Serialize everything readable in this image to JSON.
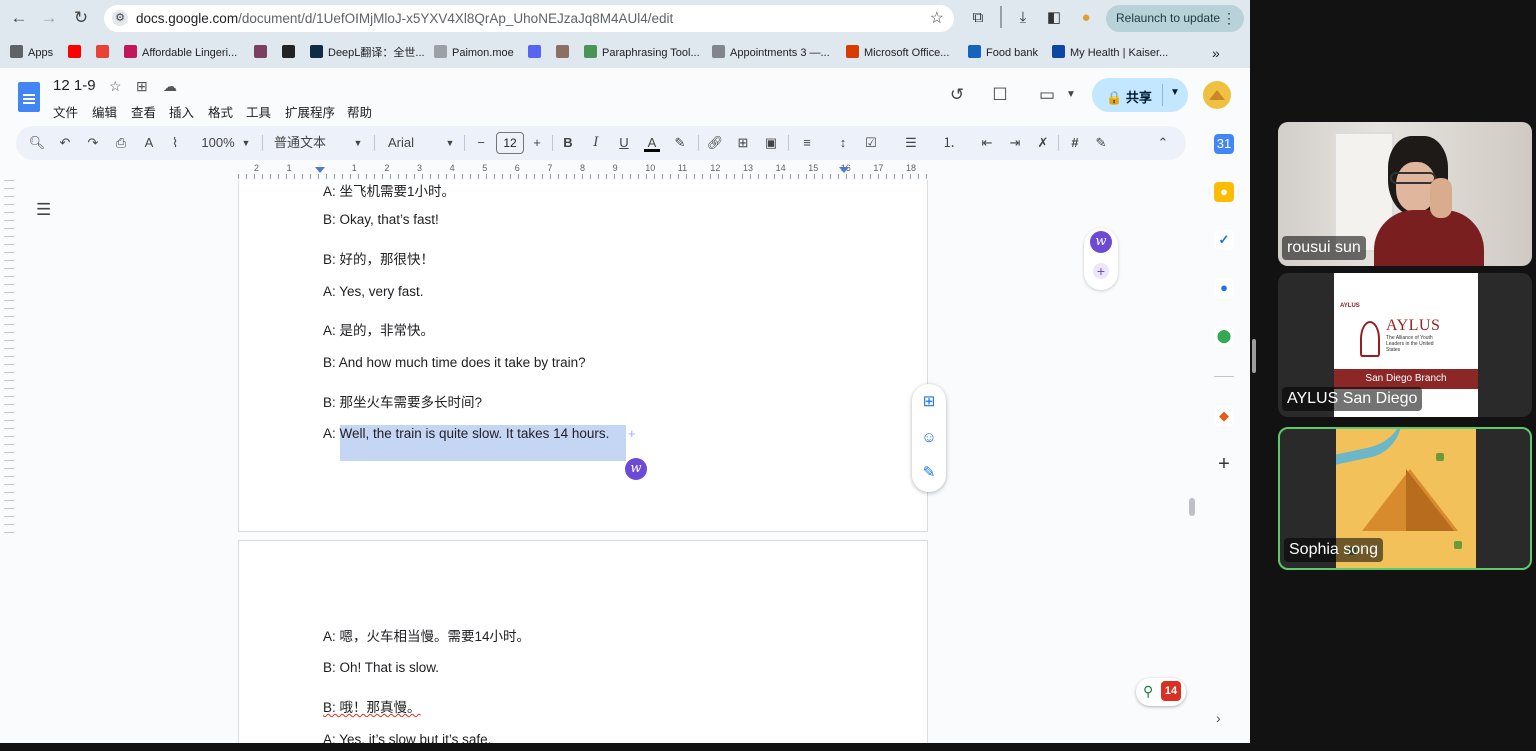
{
  "browser": {
    "url_host": "docs.google.com",
    "url_path": "/document/d/1UefOIMjMloJ-x5YXV4Xl8QrAp_UhoNEJzaJq8M4AUl4/edit",
    "relaunch_label": "Relaunch to update",
    "bookmarks": [
      {
        "label": "Apps",
        "icon": "apps-grid-icon",
        "color": "#5f6368"
      },
      {
        "label": "",
        "icon": "youtube-icon",
        "color": "#ff0000"
      },
      {
        "label": "",
        "icon": "gmail-icon",
        "color": "#ea4335"
      },
      {
        "label": "Affordable Lingeri...",
        "icon": "lingerie-site-icon",
        "color": "#c2185b"
      },
      {
        "label": "",
        "icon": "bookmark-site-icon",
        "color": "#7b3f61"
      },
      {
        "label": "",
        "icon": "amazon-icon",
        "color": "#222222"
      },
      {
        "label": "DeepL翻译：全世...",
        "icon": "deepl-icon",
        "color": "#0f2b46"
      },
      {
        "label": "Paimon.moe",
        "icon": "paimon-icon",
        "color": "#9aa0a6"
      },
      {
        "label": "",
        "icon": "discord-icon",
        "color": "#5865f2"
      },
      {
        "label": "",
        "icon": "site-icon",
        "color": "#8d6e63"
      },
      {
        "label": "Paraphrasing Tool...",
        "icon": "quillbot-icon",
        "color": "#499557"
      },
      {
        "label": "Appointments 3 —...",
        "icon": "calendar-grid-icon",
        "color": "#80868b"
      },
      {
        "label": "Microsoft Office...",
        "icon": "office-icon",
        "color": "#d83b01"
      },
      {
        "label": "Food bank",
        "icon": "foodbank-icon",
        "color": "#1565c0"
      },
      {
        "label": "My Health | Kaiser...",
        "icon": "kaiser-icon",
        "color": "#0d47a1"
      }
    ],
    "more_bookmarks": "»"
  },
  "docs": {
    "title": "12 1-9",
    "menus": [
      "文件",
      "编辑",
      "查看",
      "插入",
      "格式",
      "工具",
      "扩展程序",
      "帮助"
    ],
    "share_label": "共享",
    "zoom": "100%",
    "style": "普通文本",
    "font": "Arial",
    "font_size": "12",
    "ruler_numbers": [
      "2",
      "1",
      "",
      "1",
      "2",
      "3",
      "4",
      "5",
      "6",
      "7",
      "8",
      "9",
      "10",
      "11",
      "12",
      "13",
      "14",
      "15",
      "16",
      "17",
      "18"
    ],
    "page1_lines": [
      "A: 坐飞机需要1小时。",
      "B: Okay, that’s fast!",
      "B: 好的，那很快！",
      "A: Yes, very fast.",
      "A: 是的，非常快。",
      "B: And how much time does it take by train?",
      "B: 那坐火车需要多长时间?",
      "A: Well, the train is quite slow. It takes 14 hours."
    ],
    "page2_lines": [
      "A: 嗯，火车相当慢。需要14小时。",
      "B: Oh! That is slow.",
      "B: 哦！那真慢。",
      "A: Yes, it’s slow but it’s safe."
    ],
    "explore_badge": "14"
  },
  "meeting": {
    "participants": [
      {
        "name": "rousui sun"
      },
      {
        "name": "AYLUS San Diego",
        "card_title": "AYLUS",
        "card_band": "San Diego Branch",
        "card_sub": "The Alliance of Youth Leaders in the United States"
      },
      {
        "name": "Sophia song"
      }
    ],
    "active_speaker_color": "#5cc96a"
  }
}
